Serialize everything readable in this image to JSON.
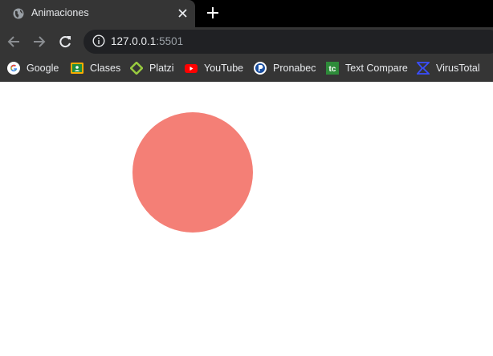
{
  "tab": {
    "title": "Animaciones"
  },
  "address_bar": {
    "host": "127.0.0.1",
    "port": ":5501"
  },
  "bookmarks": [
    {
      "label": "Google",
      "icon": "google-icon"
    },
    {
      "label": "Clases",
      "icon": "classroom-icon"
    },
    {
      "label": "Platzi",
      "icon": "platzi-icon"
    },
    {
      "label": "YouTube",
      "icon": "youtube-icon"
    },
    {
      "label": "Pronabec",
      "icon": "pronabec-icon"
    },
    {
      "label": "Text Compare",
      "icon": "text-compare-icon"
    },
    {
      "label": "VirusTotal",
      "icon": "virustotal-icon"
    }
  ],
  "page": {
    "circle_color": "#f47f76"
  }
}
